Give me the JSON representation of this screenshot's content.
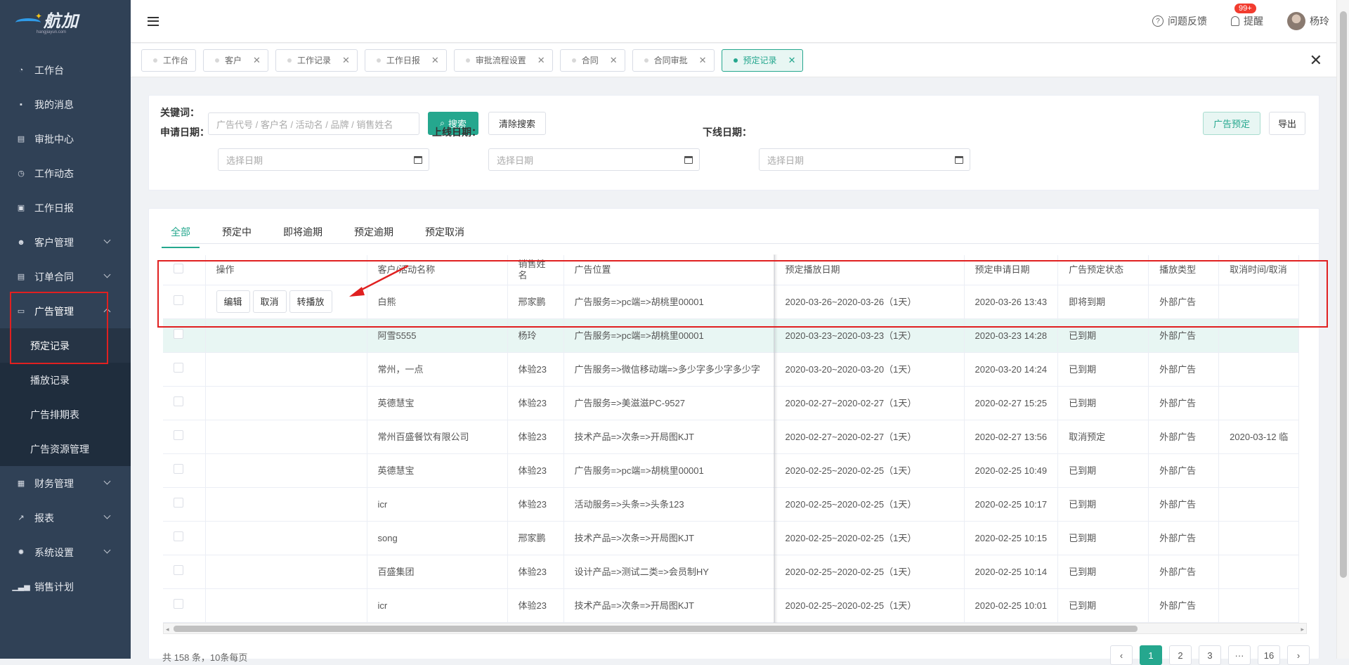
{
  "app": {
    "logo_text": "航加",
    "logo_sub": "hangjiayun.com"
  },
  "sidebar": {
    "items": [
      {
        "label": "工作台",
        "icon": "dashboard-icon",
        "glyph": "◔"
      },
      {
        "label": "我的消息",
        "icon": "message-icon",
        "glyph": "▪"
      },
      {
        "label": "审批中心",
        "icon": "approval-icon",
        "glyph": "▤"
      },
      {
        "label": "工作动态",
        "icon": "clock-icon",
        "glyph": "◷"
      },
      {
        "label": "工作日报",
        "icon": "calendar-icon",
        "glyph": "▣"
      },
      {
        "label": "客户管理",
        "icon": "users-icon",
        "glyph": "☻",
        "expandable": true
      },
      {
        "label": "订单合同",
        "icon": "document-icon",
        "glyph": "▤",
        "expandable": true
      },
      {
        "label": "广告管理",
        "icon": "monitor-icon",
        "glyph": "▭",
        "expandable": true,
        "open": true,
        "children": [
          "预定记录",
          "播放记录",
          "广告排期表",
          "广告资源管理"
        ],
        "active_child": "预定记录"
      },
      {
        "label": "财务管理",
        "icon": "finance-icon",
        "glyph": "▦",
        "expandable": true
      },
      {
        "label": "报表",
        "icon": "trend-icon",
        "glyph": "↗",
        "expandable": true
      },
      {
        "label": "系统设置",
        "icon": "gear-icon",
        "glyph": "✹",
        "expandable": true
      },
      {
        "label": "销售计划",
        "icon": "bar-chart-icon",
        "glyph": "▁▃▅"
      }
    ]
  },
  "topbar": {
    "feedback": "问题反馈",
    "reminder": "提醒",
    "badge": "99+",
    "user": "杨玲"
  },
  "tabs": [
    {
      "label": "工作台",
      "closable": false
    },
    {
      "label": "客户",
      "closable": true
    },
    {
      "label": "工作记录",
      "closable": true
    },
    {
      "label": "工作日报",
      "closable": true
    },
    {
      "label": "审批流程设置",
      "closable": true
    },
    {
      "label": "合同",
      "closable": true
    },
    {
      "label": "合同审批",
      "closable": true
    },
    {
      "label": "预定记录",
      "closable": true,
      "active": true
    }
  ],
  "close_glyph": "✕",
  "filters": {
    "keyword_label": "关键词：",
    "keyword_placeholder": "广告代号 / 客户名 / 活动名 / 品牌 / 销售姓名",
    "search_btn": "搜索",
    "clear_btn": "清除搜索",
    "apply_date_label": "申请日期：",
    "online_date_label": "上线日期：",
    "offline_date_label": "下线日期：",
    "date_placeholder": "选择日期",
    "book_btn": "广告预定",
    "export_btn": "导出"
  },
  "status_tabs": [
    "全部",
    "预定中",
    "即将逾期",
    "预定逾期",
    "预定取消"
  ],
  "table": {
    "headers": [
      "操作",
      "客户/活动名称",
      "销售姓名",
      "广告位置",
      "预定播放日期",
      "预定申请日期",
      "广告预定状态",
      "播放类型",
      "取消时间/取消"
    ],
    "row_actions": [
      "编辑",
      "取消",
      "转播放"
    ],
    "rows": [
      {
        "name": "白熊",
        "sales": "邢家鹏",
        "position": "广告服务=>pc端=>胡桃里00001",
        "play_date": "2020-03-26~2020-03-26（1天）",
        "apply_date": "2020-03-26 13:43",
        "status": "即将到期",
        "type": "外部广告",
        "cancel": ""
      },
      {
        "name": "阿雪5555",
        "sales": "杨玲",
        "position": "广告服务=>pc端=>胡桃里00001",
        "play_date": "2020-03-23~2020-03-23（1天）",
        "apply_date": "2020-03-23 14:28",
        "status": "已到期",
        "type": "外部广告",
        "cancel": ""
      },
      {
        "name": "常州，一点",
        "sales": "体验23",
        "position": "广告服务=>微信移动端=>多少字多少字多少字",
        "play_date": "2020-03-20~2020-03-20（1天）",
        "apply_date": "2020-03-20 14:24",
        "status": "已到期",
        "type": "外部广告",
        "cancel": ""
      },
      {
        "name": "英德慧宝",
        "sales": "体验23",
        "position": "广告服务=>美滋滋PC-9527",
        "play_date": "2020-02-27~2020-02-27（1天）",
        "apply_date": "2020-02-27 15:25",
        "status": "已到期",
        "type": "外部广告",
        "cancel": ""
      },
      {
        "name": "常州百盛餐饮有限公司",
        "sales": "体验23",
        "position": "技术产品=>次条=>开局图KJT",
        "play_date": "2020-02-27~2020-02-27（1天）",
        "apply_date": "2020-02-27 13:56",
        "status": "取消预定",
        "type": "外部广告",
        "cancel": "2020-03-12 临"
      },
      {
        "name": "英德慧宝",
        "sales": "体验23",
        "position": "广告服务=>pc端=>胡桃里00001",
        "play_date": "2020-02-25~2020-02-25（1天）",
        "apply_date": "2020-02-25 10:49",
        "status": "已到期",
        "type": "外部广告",
        "cancel": ""
      },
      {
        "name": "icr",
        "sales": "体验23",
        "position": "活动服务=>头条=>头条123",
        "play_date": "2020-02-25~2020-02-25（1天）",
        "apply_date": "2020-02-25 10:17",
        "status": "已到期",
        "type": "外部广告",
        "cancel": ""
      },
      {
        "name": "song",
        "sales": "邢家鹏",
        "position": "技术产品=>次条=>开局图KJT",
        "play_date": "2020-02-25~2020-02-25（1天）",
        "apply_date": "2020-02-25 10:15",
        "status": "已到期",
        "type": "外部广告",
        "cancel": ""
      },
      {
        "name": "百盛集团",
        "sales": "体验23",
        "position": "设计产品=>测试二类=>会员制HY",
        "play_date": "2020-02-25~2020-02-25（1天）",
        "apply_date": "2020-02-25 10:14",
        "status": "已到期",
        "type": "外部广告",
        "cancel": ""
      },
      {
        "name": "icr",
        "sales": "体验23",
        "position": "技术产品=>次条=>开局图KJT",
        "play_date": "2020-02-25~2020-02-25（1天）",
        "apply_date": "2020-02-25 10:01",
        "status": "已到期",
        "type": "外部广告",
        "cancel": ""
      }
    ]
  },
  "footer": {
    "summary": "共 158 条，10条每页",
    "pages": [
      "‹",
      "1",
      "2",
      "3",
      "···",
      "16",
      "›"
    ],
    "current_page": "1"
  },
  "colors": {
    "accent": "#25a78e",
    "sidebar_bg": "#304156",
    "highlight": "#e02020"
  }
}
